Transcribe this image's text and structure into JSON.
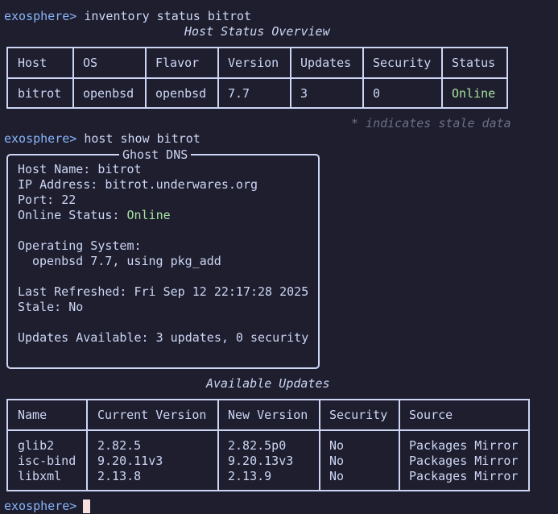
{
  "prompt": "exosphere>",
  "cmd1": "inventory status bitrot",
  "overview": {
    "title": "Host Status Overview",
    "headers": [
      "Host",
      "OS",
      "Flavor",
      "Version",
      "Updates",
      "Security",
      "Status"
    ],
    "row": [
      "bitrot",
      "openbsd",
      "openbsd",
      "7.7",
      "3",
      "0",
      "Online"
    ],
    "footnote": "* indicates stale data"
  },
  "cmd2": "host show bitrot",
  "panel": {
    "title": "Ghost DNS",
    "host_name_label": "Host Name:",
    "host_name": "bitrot",
    "ip_label": "IP Address:",
    "ip": "bitrot.underwares.org",
    "port_label": "Port:",
    "port": "22",
    "online_label": "Online Status:",
    "online": "Online",
    "os_label": "Operating System:",
    "os_value": "openbsd 7.7, using pkg_add",
    "refreshed_label": "Last Refreshed:",
    "refreshed": "Fri Sep 12 22:17:28 2025",
    "stale_label": "Stale:",
    "stale": "No",
    "updates_label": "Updates Available:",
    "updates": "3 updates, 0 security"
  },
  "updates": {
    "title": "Available Updates",
    "headers": [
      "Name",
      "Current Version",
      "New Version",
      "Security",
      "Source"
    ],
    "rows": [
      [
        "glib2",
        "2.82.5",
        "2.82.5p0",
        "No",
        "Packages Mirror"
      ],
      [
        "isc-bind",
        "9.20.11v3",
        "9.20.13v3",
        "No",
        "Packages Mirror"
      ],
      [
        "libxml",
        "2.13.8",
        "2.13.9",
        "No",
        "Packages Mirror"
      ]
    ]
  },
  "colors": {
    "background": "#1e1e2e",
    "text": "#cdd6f4",
    "prompt": "#89b4fa",
    "online": "#a6e3a1",
    "dim": "#6c7086",
    "cursor": "#f5e0dc"
  }
}
